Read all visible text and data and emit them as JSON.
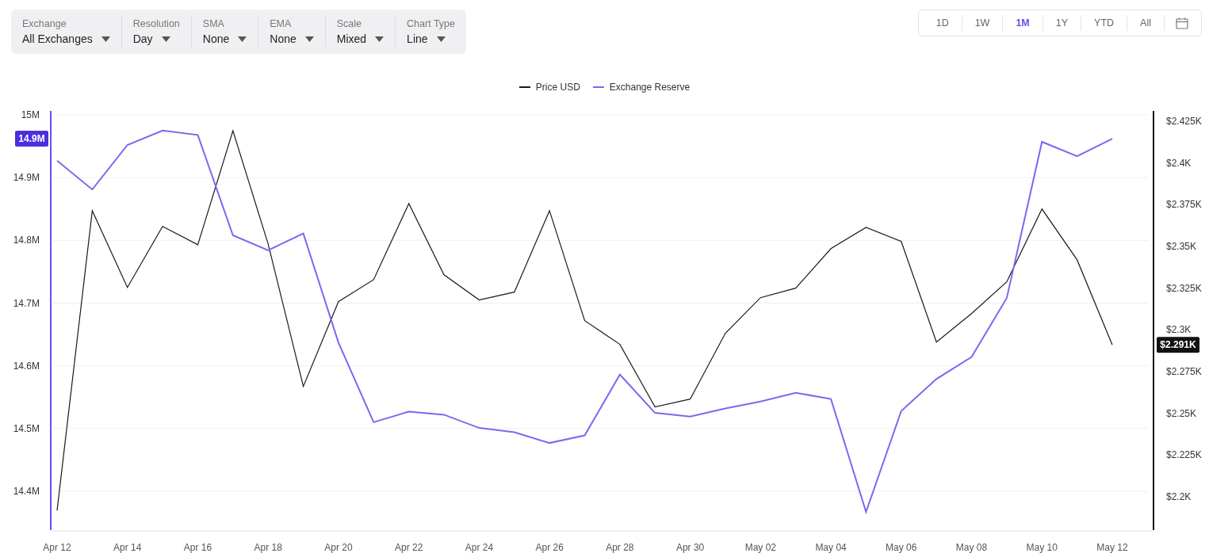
{
  "filters": [
    {
      "label": "Exchange",
      "value": "All Exchanges"
    },
    {
      "label": "Resolution",
      "value": "Day"
    },
    {
      "label": "SMA",
      "value": "None"
    },
    {
      "label": "EMA",
      "value": "None"
    },
    {
      "label": "Scale",
      "value": "Mixed"
    },
    {
      "label": "Chart Type",
      "value": "Line"
    }
  ],
  "ranges": [
    {
      "label": "1D",
      "selected": false
    },
    {
      "label": "1W",
      "selected": false
    },
    {
      "label": "1M",
      "selected": true
    },
    {
      "label": "1Y",
      "selected": false
    },
    {
      "label": "YTD",
      "selected": false
    },
    {
      "label": "All",
      "selected": false
    }
  ],
  "chart_data": {
    "type": "line",
    "categories": [
      "Apr 12",
      null,
      "Apr 14",
      null,
      "Apr 16",
      null,
      "Apr 18",
      null,
      "Apr 20",
      null,
      "Apr 22",
      null,
      "Apr 24",
      null,
      "Apr 26",
      null,
      "Apr 28",
      null,
      "Apr 30",
      null,
      "May 02",
      null,
      "May 04",
      null,
      "May 06",
      null,
      "May 08",
      null,
      "May 10",
      null,
      "May 12"
    ],
    "series": [
      {
        "name": "Price USD",
        "color": "#1a1a1a",
        "axis": "y2",
        "values": [
          2191.7,
          2371.4,
          2325.4,
          2362,
          2351,
          2419.3,
          2351.5,
          2266.1,
          2316.9,
          2330.1,
          2375.7,
          2333,
          2317.9,
          2322.6,
          2371.4,
          2305.5,
          2291.3,
          2253.8,
          2258.5,
          2298,
          2319.3,
          2325,
          2348.7,
          2361.4,
          2353,
          2292.7,
          2309.8,
          2328.8,
          2372.4,
          2342,
          2291
        ]
      },
      {
        "name": "Exchange Reserve",
        "color": "#7b68ee",
        "values": [
          14.927,
          14.881,
          14.952,
          14.975,
          14.968,
          14.808,
          14.784,
          14.811,
          14.637,
          14.51,
          14.527,
          14.522,
          14.501,
          14.494,
          14.477,
          14.489,
          14.586,
          14.525,
          14.519,
          14.532,
          14.543,
          14.557,
          14.547,
          14.367,
          14.528,
          14.579,
          14.614,
          14.708,
          14.957,
          14.934,
          14.962
        ]
      }
    ],
    "ylim": [
      14.3394,
      15.0063
    ],
    "yticks": [
      {
        "value": 15,
        "label": "15M"
      },
      {
        "value": 14.9,
        "label": "14.9M"
      },
      {
        "value": 14.8,
        "label": "14.8M"
      },
      {
        "value": 14.7,
        "label": "14.7M"
      },
      {
        "value": 14.6,
        "label": "14.6M"
      },
      {
        "value": 14.5,
        "label": "14.5M"
      },
      {
        "value": 14.4,
        "label": "14.4M"
      }
    ],
    "y2lim": [
      2180.5,
      2431.2
    ],
    "y2ticks": [
      {
        "value": 2425,
        "label": "$2.425K"
      },
      {
        "value": 2400,
        "label": "$2.4K"
      },
      {
        "value": 2375,
        "label": "$2.375K"
      },
      {
        "value": 2350,
        "label": "$2.35K"
      },
      {
        "value": 2325,
        "label": "$2.325K"
      },
      {
        "value": 2300,
        "label": "$2.3K"
      },
      {
        "value": 2275,
        "label": "$2.275K"
      },
      {
        "value": 2250,
        "label": "$2.25K"
      },
      {
        "value": 2225,
        "label": "$2.225K"
      },
      {
        "value": 2200,
        "label": "$2.2K"
      }
    ],
    "grid": true,
    "annotations": [
      "14.9M",
      "$2.291K"
    ]
  }
}
